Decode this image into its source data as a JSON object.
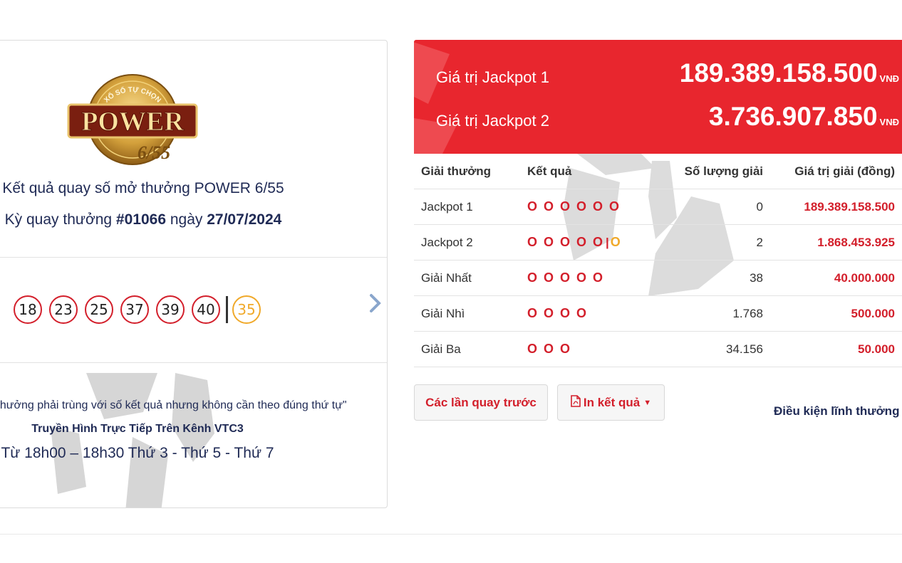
{
  "left": {
    "logo": {
      "arc_text": "XỔ SỐ TỰ CHỌN",
      "word": "POWER",
      "number": "6/55"
    },
    "title": "Kết quả quay số mở thưởng POWER 6/55",
    "draw_prefix": "Kỳ quay thưởng",
    "draw_number": "#01066",
    "draw_mid": "ngày",
    "draw_date": "27/07/2024",
    "balls": [
      "18",
      "23",
      "25",
      "37",
      "39",
      "40"
    ],
    "special_ball": "35",
    "quote": "thưởng phải trùng với số kết quả nhưng không cần theo đúng thứ tự\"",
    "broadcast": "Truyền Hình Trực Tiếp Trên Kênh VTC3",
    "schedule": "Từ 18h00 – 18h30 Thứ 3 - Thứ 5 - Thứ 7"
  },
  "jackpot": {
    "jp1_label": "Giá trị Jackpot 1",
    "jp1_value": "189.389.158.500",
    "jp2_label": "Giá trị Jackpot 2",
    "jp2_value": "3.736.907.850",
    "unit": "VNĐ"
  },
  "table": {
    "headers": [
      "Giải thưởng",
      "Kết quả",
      "Số lượng giải",
      "Giá trị giải (đồng)"
    ],
    "rows": [
      {
        "prize": "Jackpot 1",
        "marks": "O O O O O O",
        "special": "",
        "count": "0",
        "value": "189.389.158.500"
      },
      {
        "prize": "Jackpot 2",
        "marks": "O O O O O",
        "special": "O",
        "count": "2",
        "value": "1.868.453.925"
      },
      {
        "prize": "Giải Nhất",
        "marks": "O O O O O",
        "special": "",
        "count": "38",
        "value": "40.000.000"
      },
      {
        "prize": "Giải Nhì",
        "marks": "O O O O",
        "special": "",
        "count": "1.768",
        "value": "500.000"
      },
      {
        "prize": "Giải Ba",
        "marks": "O O O",
        "special": "",
        "count": "34.156",
        "value": "50.000"
      }
    ]
  },
  "actions": {
    "prev_draws": "Các lần quay trước",
    "print_results": "In kết quả",
    "conditions": "Điều kiện lĩnh thưởng"
  },
  "icons": {
    "next": "chevron-right-icon",
    "pdf": "pdf-file-icon",
    "caret": "caret-down-icon"
  },
  "colors": {
    "red": "#e8262e",
    "prize_red": "#d31f2b",
    "special": "#f0a92a",
    "navy": "#1f2a55"
  }
}
